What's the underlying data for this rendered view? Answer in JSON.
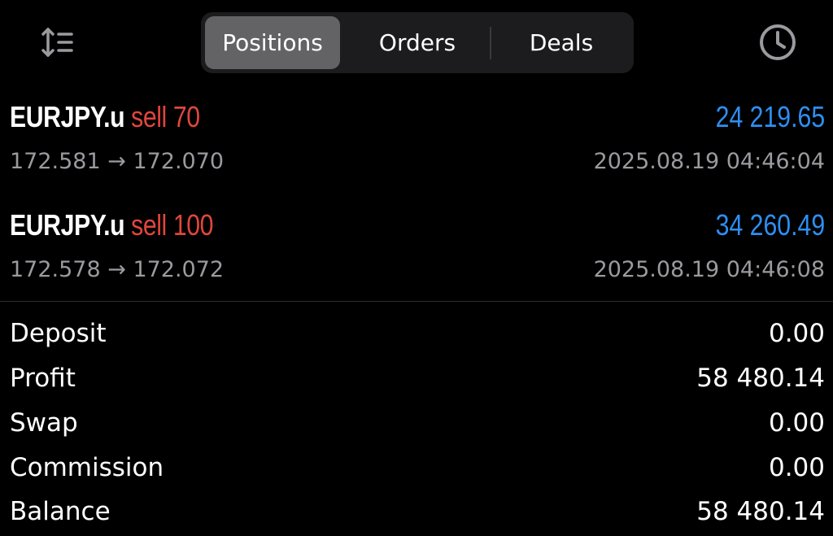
{
  "tabs": {
    "positions": "Positions",
    "orders": "Orders",
    "deals": "Deals",
    "active": "positions"
  },
  "icons": {
    "sort": "sort-icon",
    "history": "clock-icon"
  },
  "colors": {
    "background": "#000000",
    "sell": "#e0463c",
    "profit": "#2d8ff2",
    "secondary_text": "#9a9a9f"
  },
  "positions": [
    {
      "symbol": "EURJPY.u",
      "side": "sell 70",
      "profit": "24 219.65",
      "prices": "172.581 → 172.070",
      "time": "2025.08.19 04:46:04"
    },
    {
      "symbol": "EURJPY.u",
      "side": "sell 100",
      "profit": "34 260.49",
      "prices": "172.578 → 172.072",
      "time": "2025.08.19 04:46:08"
    }
  ],
  "summary": [
    {
      "label": "Deposit",
      "value": "0.00"
    },
    {
      "label": "Profit",
      "value": "58 480.14"
    },
    {
      "label": "Swap",
      "value": "0.00"
    },
    {
      "label": "Commission",
      "value": "0.00"
    },
    {
      "label": "Balance",
      "value": "58 480.14"
    }
  ]
}
